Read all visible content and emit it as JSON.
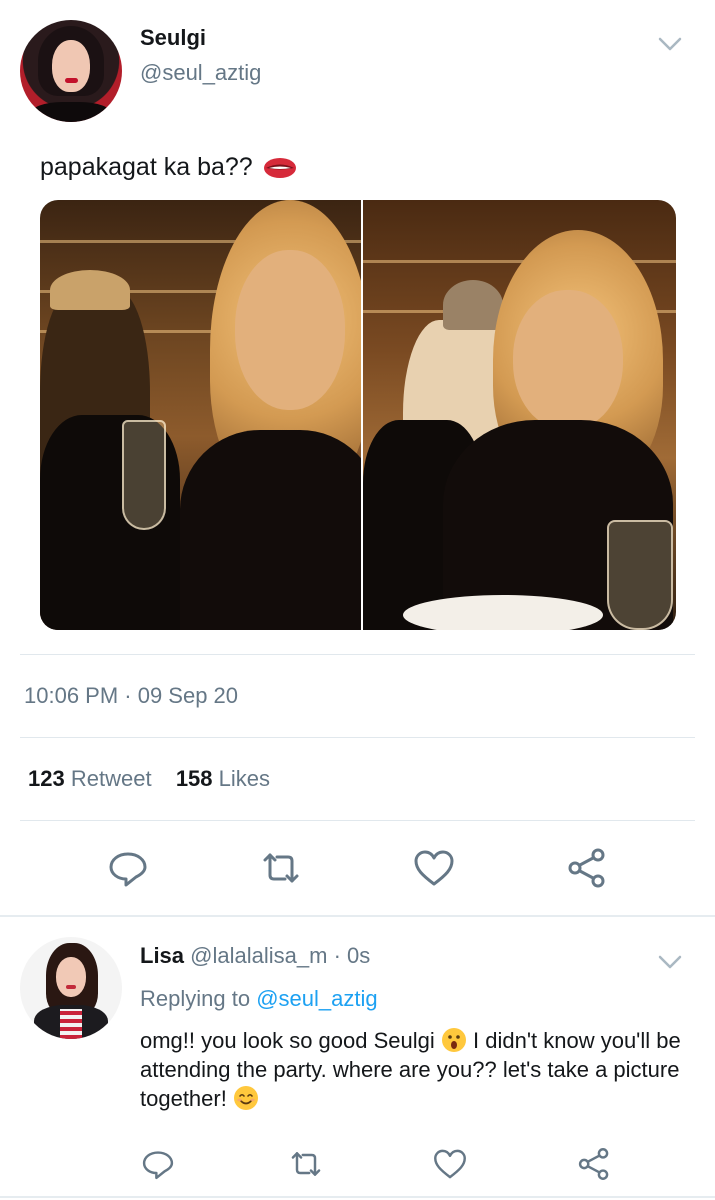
{
  "tweet": {
    "author_name": "Seulgi",
    "author_handle": "@seul_aztig",
    "text": "papakagat ka ba??",
    "text_emoji": "lips-emoji",
    "timestamp": "10:06 PM · 09 Sep 20",
    "stats": {
      "retweets_count": "123",
      "retweets_label": "Retweet",
      "likes_count": "158",
      "likes_label": "Likes"
    },
    "actions": [
      "reply-icon",
      "retweet-icon",
      "like-icon",
      "share-icon"
    ]
  },
  "reply": {
    "author_name": "Lisa",
    "author_handle": "@lalalalisa_m",
    "time": "· 0s",
    "replying_prefix": "Replying to",
    "replying_to": "@seul_aztig",
    "text_part1": "omg!! you look so good Seulgi",
    "text_part2": "I didn't know you'll be attending the party. where are you?? let's take a picture together!",
    "emoji1": "hushed-face-emoji",
    "emoji2": "smiling-face-emoji",
    "actions": [
      "reply-icon",
      "retweet-icon",
      "like-icon",
      "share-icon"
    ]
  },
  "colors": {
    "text_primary": "#14171a",
    "text_secondary": "#657786",
    "link": "#1da1f2",
    "divider": "#e1e8ed"
  }
}
